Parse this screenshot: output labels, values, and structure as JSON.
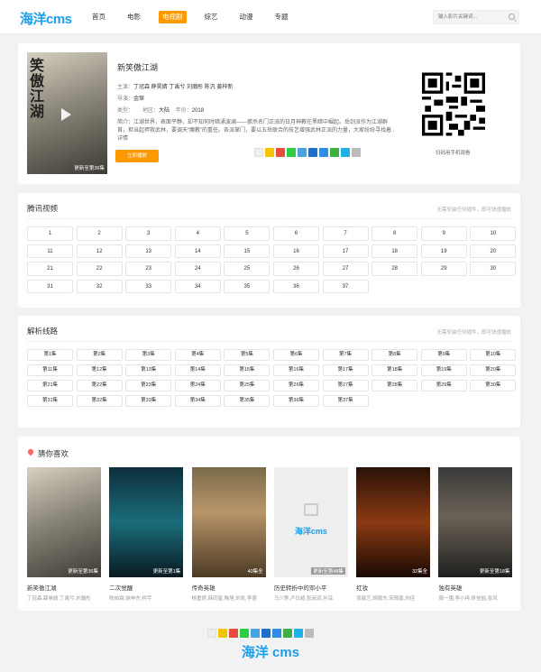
{
  "header": {
    "logo": "海洋cms",
    "nav": [
      "首页",
      "电影",
      "电视剧",
      "综艺",
      "动漫",
      "专题"
    ],
    "active_nav": "电视剧",
    "search_placeholder": "输入影片关键词..."
  },
  "detail": {
    "title": "新笑傲江湖",
    "cast_label": "主演：",
    "cast": "丁冠森  薛昊婧  丁禹兮  刘瀚彤  陈汎  姜梓新",
    "director_label": "导演：",
    "director": "金琛",
    "type_label": "类型：",
    "region_label": "地区：",
    "region": "大陆",
    "year_label": "年份：",
    "year": "2018",
    "intro_label": "简介：",
    "intro": "江湖世界，表面平静，却不知何时暗涌波澜——掳杀名门正派的日月神教在黑暗中崛起。岳剑派作为江湖群首，担当起捍救武林，要调天“魔教”的重任。各派掌门，要以五岳联合的技艺增强武林正派的力量，大家纷纷寻找着..",
    "intro_more": "详情",
    "poster_chars": "笑傲江湖",
    "poster_tag": "更新至第36集",
    "play_button": "立即播放",
    "qr_caption": "扫码用手机观看"
  },
  "tencent": {
    "title": "腾讯视频",
    "note": "无需安装任何插件，即可快速播放",
    "episodes": [
      "1",
      "2",
      "3",
      "4",
      "5",
      "6",
      "7",
      "8",
      "9",
      "10",
      "11",
      "12",
      "13",
      "14",
      "15",
      "16",
      "17",
      "18",
      "19",
      "20",
      "21",
      "22",
      "23",
      "24",
      "25",
      "26",
      "27",
      "28",
      "29",
      "30",
      "31",
      "32",
      "33",
      "34",
      "35",
      "36",
      "37"
    ]
  },
  "parse": {
    "title": "解析线路",
    "note": "无需安装任何插件，即可快速播放",
    "episodes": [
      "第1集",
      "第2集",
      "第3集",
      "第4集",
      "第5集",
      "第6集",
      "第7集",
      "第8集",
      "第9集",
      "第10集",
      "第11集",
      "第12集",
      "第13集",
      "第14集",
      "第15集",
      "第16集",
      "第17集",
      "第18集",
      "第19集",
      "第20集",
      "第21集",
      "第22集",
      "第23集",
      "第24集",
      "第25集",
      "第26集",
      "第27集",
      "第28集",
      "第29集",
      "第30集",
      "第31集",
      "第32集",
      "第33集",
      "第34集",
      "第35集",
      "第36集",
      "第37集"
    ]
  },
  "recommend": {
    "title": "猜你喜欢",
    "items": [
      {
        "name": "新笑傲江湖",
        "actors": "丁冠森,薛昊婧,丁禹兮,刘瀚彤",
        "tag": "更新至第36集"
      },
      {
        "name": "二次觉醒",
        "actors": "陈柏霖,徐申东,柯宇",
        "tag": "更新至第1集"
      },
      {
        "name": "传奇英雄",
        "actors": "杨重妍,韩同星,陶旭,刘凯,李德",
        "tag": "40集全"
      },
      {
        "name": "历史转折中的邓小平",
        "actors": "马少骅,卢日超,张淑润,孙淳,",
        "tag": "更新至第48集"
      },
      {
        "name": "红妆",
        "actors": "张歆艺,胡佩东,宋佩鑫,刘佳",
        "tag": "32集全"
      },
      {
        "name": "独有英雄",
        "actors": "周一围,李小冉,佟信喆,张风",
        "tag": "更新至第18集"
      }
    ],
    "placeholder_logo": "海洋cms"
  },
  "footer": {
    "logo": "海洋 cms"
  }
}
